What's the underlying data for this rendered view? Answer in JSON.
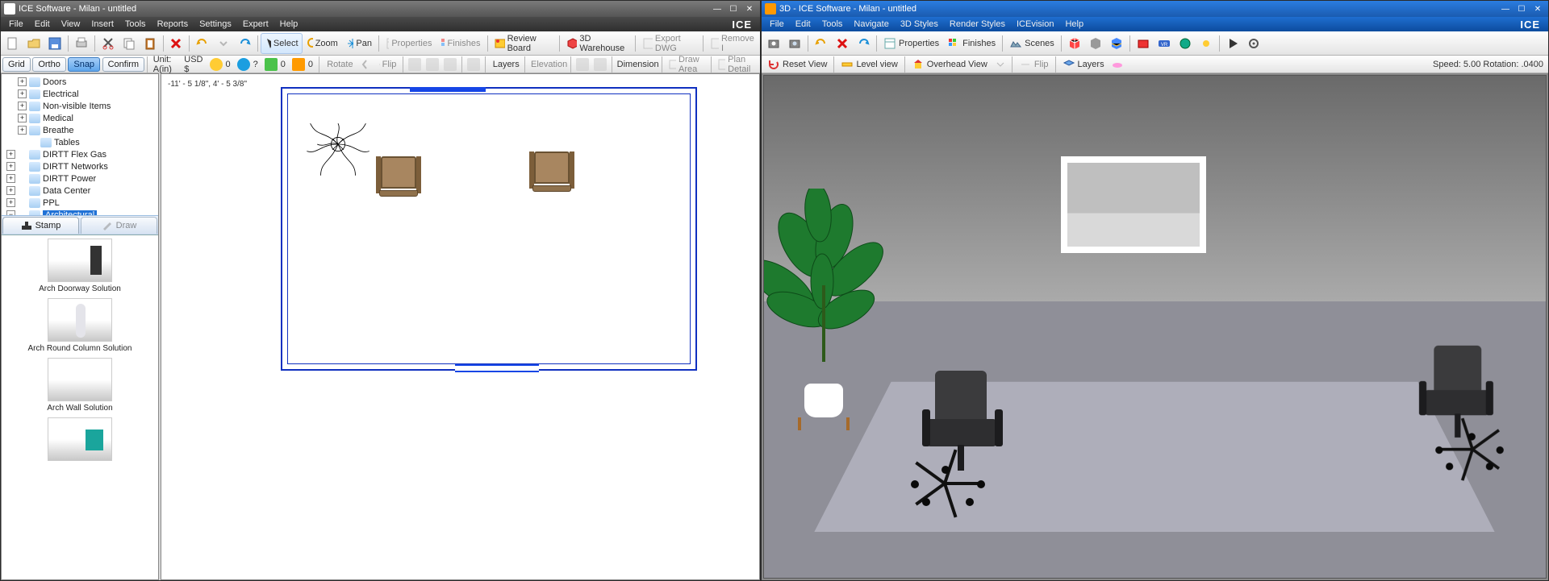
{
  "left": {
    "title": "ICE Software - Milan - untitled",
    "menus": [
      "File",
      "Edit",
      "View",
      "Insert",
      "Tools",
      "Reports",
      "Settings",
      "Expert",
      "Help"
    ],
    "brand": "ICE",
    "toolbar1": {
      "select": "Select",
      "zoom": "Zoom",
      "pan": "Pan",
      "properties": "Properties",
      "finishes": "Finishes",
      "review": "Review Board",
      "warehouse": "3D Warehouse",
      "exportdwg": "Export DWG",
      "removei": "Remove I"
    },
    "toolbar2": {
      "grid": "Grid",
      "ortho": "Ortho",
      "snap": "Snap",
      "confirm": "Confirm",
      "unit": "Unit: A(in)",
      "currency": "USD $",
      "quoteCount": "0",
      "trash": "?",
      "potCount": "0",
      "stampCount": "0",
      "rotate": "Rotate",
      "flip": "Flip",
      "layers": "Layers",
      "elevation": "Elevation",
      "dimension": "Dimension",
      "drawarea": "Draw Area",
      "plandetail": "Plan Detail"
    },
    "tree": [
      {
        "label": "Doors",
        "depth": 1
      },
      {
        "label": "Electrical",
        "depth": 1
      },
      {
        "label": "Non-visible Items",
        "depth": 1
      },
      {
        "label": "Medical",
        "depth": 1
      },
      {
        "label": "Breathe",
        "depth": 1
      },
      {
        "label": "Tables",
        "depth": 2,
        "noexp": true
      },
      {
        "label": "DIRTT Flex Gas",
        "depth": 0
      },
      {
        "label": "DIRTT Networks",
        "depth": 0
      },
      {
        "label": "DIRTT Power",
        "depth": 0
      },
      {
        "label": "Data Center",
        "depth": 0
      },
      {
        "label": "PPL",
        "depth": 0
      },
      {
        "label": "Architectural",
        "depth": 0,
        "selected": true
      }
    ],
    "tabs": {
      "stamp": "Stamp",
      "draw": "Draw"
    },
    "stamps": [
      "Arch Doorway Solution",
      "Arch Round Column Solution",
      "Arch Wall Solution"
    ],
    "coord": "-11' - 5 1/8\", 4' - 5 3/8\""
  },
  "right": {
    "title": "3D - ICE Software - Milan - untitled",
    "menus": [
      "File",
      "Edit",
      "Tools",
      "Navigate",
      "3D Styles",
      "Render Styles",
      "ICEvision",
      "Help"
    ],
    "brand": "ICE",
    "toolbar1": {
      "properties": "Properties",
      "finishes": "Finishes",
      "scenes": "Scenes"
    },
    "toolbar2": {
      "reset": "Reset View",
      "level": "Level view",
      "overhead": "Overhead View",
      "flip": "Flip",
      "layers": "Layers"
    },
    "speed": "Speed: 5.00 Rotation: .0400"
  }
}
